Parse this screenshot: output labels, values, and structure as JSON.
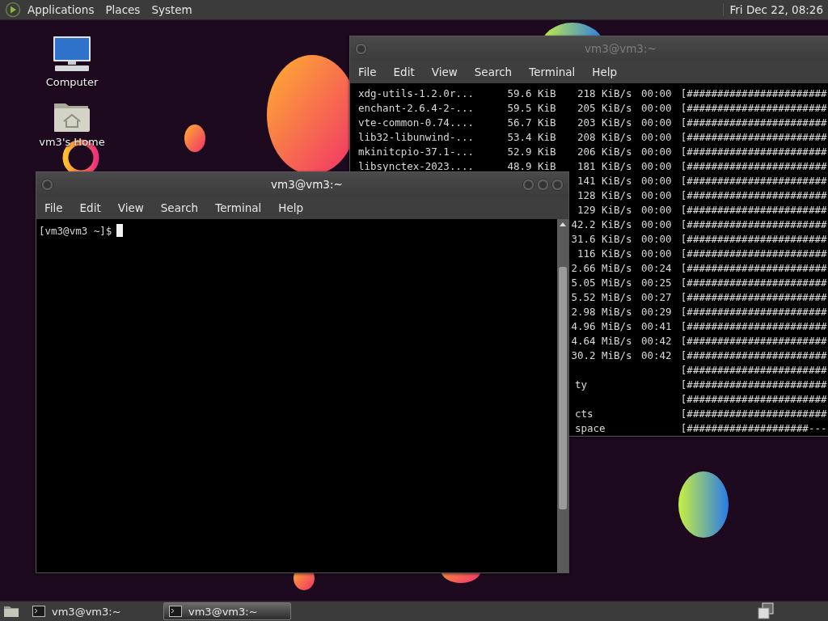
{
  "top_panel": {
    "menus": [
      "Applications",
      "Places",
      "System"
    ],
    "clock": "Fri Dec 22, 08:26"
  },
  "desktop_icons": [
    {
      "label": "Computer",
      "kind": "computer"
    },
    {
      "label": "vm3's Home",
      "kind": "home"
    }
  ],
  "back_window": {
    "title": "vm3@vm3:~",
    "focused": false,
    "menus": [
      "File",
      "Edit",
      "View",
      "Search",
      "Terminal",
      "Help"
    ],
    "rows": [
      {
        "name": "xdg-utils-1.2.0r...",
        "size": "59.6 KiB",
        "speed": "218 KiB/s",
        "eta": "00:00",
        "bar": "[#######################"
      },
      {
        "name": "enchant-2.6.4-2-...",
        "size": "59.5 KiB",
        "speed": "205 KiB/s",
        "eta": "00:00",
        "bar": "[#######################"
      },
      {
        "name": "vte-common-0.74....",
        "size": "56.7 KiB",
        "speed": "203 KiB/s",
        "eta": "00:00",
        "bar": "[#######################"
      },
      {
        "name": "lib32-libunwind-...",
        "size": "53.4 KiB",
        "speed": "208 KiB/s",
        "eta": "00:00",
        "bar": "[#######################"
      },
      {
        "name": "mkinitcpio-37.1-...",
        "size": "52.9 KiB",
        "speed": "206 KiB/s",
        "eta": "00:00",
        "bar": "[#######################"
      },
      {
        "name": "libsynctex-2023....",
        "size": "48.9 KiB",
        "speed": "181 KiB/s",
        "eta": "00:00",
        "bar": "[#######################"
      },
      {
        "speed": "141 KiB/s",
        "eta": "00:00",
        "bar": "[#######################"
      },
      {
        "speed": "128 KiB/s",
        "eta": "00:00",
        "bar": "[#######################"
      },
      {
        "speed": "129 KiB/s",
        "eta": "00:00",
        "bar": "[#######################"
      },
      {
        "speed": "42.2 KiB/s",
        "eta": "00:00",
        "bar": "[#######################"
      },
      {
        "speed": "31.6 KiB/s",
        "eta": "00:00",
        "bar": "[#######################"
      },
      {
        "speed": "116 KiB/s",
        "eta": "00:00",
        "bar": "[#######################"
      },
      {
        "speed": "2.66 MiB/s",
        "eta": "00:24",
        "bar": "[#######################"
      },
      {
        "speed": "5.05 MiB/s",
        "eta": "00:25",
        "bar": "[#######################"
      },
      {
        "speed": "5.52 MiB/s",
        "eta": "00:27",
        "bar": "[#######################"
      },
      {
        "speed": "2.98 MiB/s",
        "eta": "00:29",
        "bar": "[#######################"
      },
      {
        "speed": "4.96 MiB/s",
        "eta": "00:41",
        "bar": "[#######################"
      },
      {
        "speed": "4.64 MiB/s",
        "eta": "00:42",
        "bar": "[#######################"
      },
      {
        "speed": "30.2 MiB/s",
        "eta": "00:42",
        "bar": "[#######################"
      },
      {
        "bar": "[#######################"
      },
      {
        "tail": "ty",
        "bar": "[#######################"
      },
      {
        "bar": "[#######################"
      },
      {
        "tail": "cts",
        "bar": "[#######################"
      },
      {
        "tail": "space",
        "bar": "[####################---"
      }
    ]
  },
  "front_window": {
    "title": "vm3@vm3:~",
    "focused": true,
    "menus": [
      "File",
      "Edit",
      "View",
      "Search",
      "Terminal",
      "Help"
    ],
    "prompt": "[vm3@vm3 ~]$"
  },
  "taskbar": {
    "tasks": [
      {
        "label": "vm3@vm3:~",
        "selected": false
      },
      {
        "label": "vm3@vm3:~",
        "selected": true
      }
    ]
  }
}
